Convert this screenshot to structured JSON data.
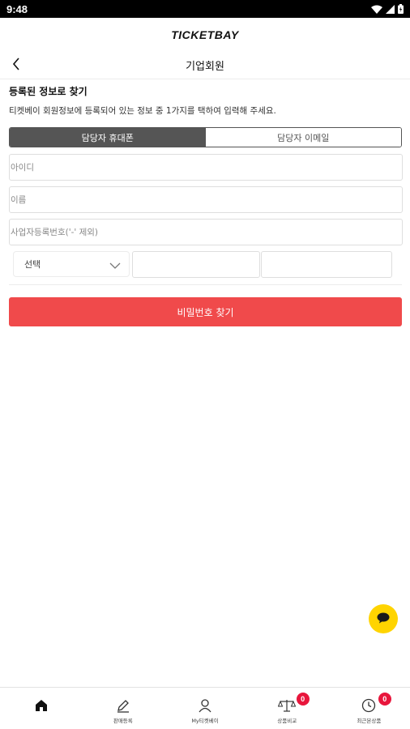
{
  "status_bar": {
    "time": "9:48"
  },
  "brand": {
    "logo_text": "TICKETBAY"
  },
  "header": {
    "title": "기업회원"
  },
  "section": {
    "title": "등록된 정보로 찾기",
    "description": "티켓베이 회원정보에 등록되어 있는 정보 중 1가지를 택하여 입력해 주세요."
  },
  "tabs": [
    {
      "label": "담당자 휴대폰",
      "active": true
    },
    {
      "label": "담당자 이메일",
      "active": false
    }
  ],
  "form": {
    "id_placeholder": "아이디",
    "name_placeholder": "이름",
    "bizno_placeholder": "사업자등록번호('-' 제외)",
    "phone_prefix_select": "선택",
    "phone_middle_value": "",
    "phone_last_value": ""
  },
  "submit_label": "비밀번호 찾기",
  "bottom_nav": [
    {
      "label": "",
      "icon": "home-icon"
    },
    {
      "label": "판매등록",
      "icon": "pencil-icon"
    },
    {
      "label": "My티켓베이",
      "icon": "person-icon"
    },
    {
      "label": "상품비교",
      "icon": "scale-icon",
      "badge": "0"
    },
    {
      "label": "최근본상품",
      "icon": "clock-icon",
      "badge": "0"
    }
  ],
  "colors": {
    "accent": "#f04a4b",
    "tab_active": "#555555",
    "chat_fab": "#ffd400",
    "badge": "#e8163c"
  }
}
